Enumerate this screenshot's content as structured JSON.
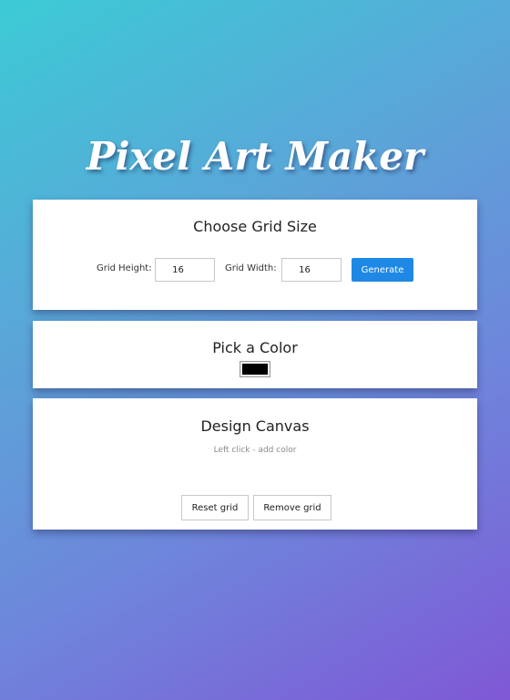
{
  "app": {
    "title": "Pixel Art Maker"
  },
  "grid_size": {
    "heading": "Choose Grid Size",
    "height_label": "Grid Height:",
    "height_value": "16",
    "width_label": "Grid Width:",
    "width_value": "16",
    "generate_label": "Generate"
  },
  "color_picker": {
    "heading": "Pick a Color",
    "selected_color": "#000000"
  },
  "canvas": {
    "heading": "Design Canvas",
    "hint": "Left click - add color",
    "reset_label": "Reset grid",
    "remove_label": "Remove grid"
  },
  "colors": {
    "accent": "#1e88e5",
    "background_start": "#3ccbd6",
    "background_end": "#7f58d6"
  }
}
